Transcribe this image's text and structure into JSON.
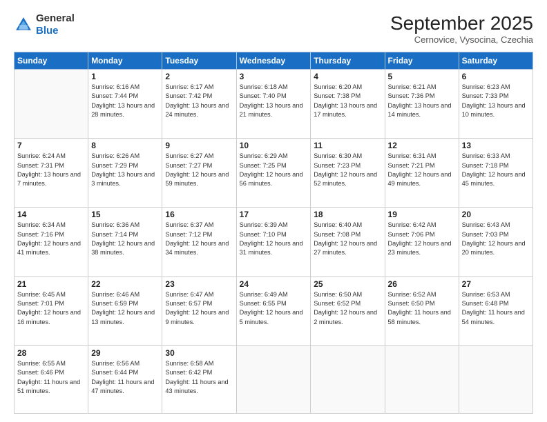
{
  "header": {
    "logo_line1": "General",
    "logo_line2": "Blue",
    "month": "September 2025",
    "location": "Cernovice, Vysocina, Czechia"
  },
  "days_of_week": [
    "Sunday",
    "Monday",
    "Tuesday",
    "Wednesday",
    "Thursday",
    "Friday",
    "Saturday"
  ],
  "weeks": [
    [
      {
        "day": "",
        "info": ""
      },
      {
        "day": "1",
        "info": "Sunrise: 6:16 AM\nSunset: 7:44 PM\nDaylight: 13 hours and 28 minutes."
      },
      {
        "day": "2",
        "info": "Sunrise: 6:17 AM\nSunset: 7:42 PM\nDaylight: 13 hours and 24 minutes."
      },
      {
        "day": "3",
        "info": "Sunrise: 6:18 AM\nSunset: 7:40 PM\nDaylight: 13 hours and 21 minutes."
      },
      {
        "day": "4",
        "info": "Sunrise: 6:20 AM\nSunset: 7:38 PM\nDaylight: 13 hours and 17 minutes."
      },
      {
        "day": "5",
        "info": "Sunrise: 6:21 AM\nSunset: 7:36 PM\nDaylight: 13 hours and 14 minutes."
      },
      {
        "day": "6",
        "info": "Sunrise: 6:23 AM\nSunset: 7:33 PM\nDaylight: 13 hours and 10 minutes."
      }
    ],
    [
      {
        "day": "7",
        "info": "Sunrise: 6:24 AM\nSunset: 7:31 PM\nDaylight: 13 hours and 7 minutes."
      },
      {
        "day": "8",
        "info": "Sunrise: 6:26 AM\nSunset: 7:29 PM\nDaylight: 13 hours and 3 minutes."
      },
      {
        "day": "9",
        "info": "Sunrise: 6:27 AM\nSunset: 7:27 PM\nDaylight: 12 hours and 59 minutes."
      },
      {
        "day": "10",
        "info": "Sunrise: 6:29 AM\nSunset: 7:25 PM\nDaylight: 12 hours and 56 minutes."
      },
      {
        "day": "11",
        "info": "Sunrise: 6:30 AM\nSunset: 7:23 PM\nDaylight: 12 hours and 52 minutes."
      },
      {
        "day": "12",
        "info": "Sunrise: 6:31 AM\nSunset: 7:21 PM\nDaylight: 12 hours and 49 minutes."
      },
      {
        "day": "13",
        "info": "Sunrise: 6:33 AM\nSunset: 7:18 PM\nDaylight: 12 hours and 45 minutes."
      }
    ],
    [
      {
        "day": "14",
        "info": "Sunrise: 6:34 AM\nSunset: 7:16 PM\nDaylight: 12 hours and 41 minutes."
      },
      {
        "day": "15",
        "info": "Sunrise: 6:36 AM\nSunset: 7:14 PM\nDaylight: 12 hours and 38 minutes."
      },
      {
        "day": "16",
        "info": "Sunrise: 6:37 AM\nSunset: 7:12 PM\nDaylight: 12 hours and 34 minutes."
      },
      {
        "day": "17",
        "info": "Sunrise: 6:39 AM\nSunset: 7:10 PM\nDaylight: 12 hours and 31 minutes."
      },
      {
        "day": "18",
        "info": "Sunrise: 6:40 AM\nSunset: 7:08 PM\nDaylight: 12 hours and 27 minutes."
      },
      {
        "day": "19",
        "info": "Sunrise: 6:42 AM\nSunset: 7:06 PM\nDaylight: 12 hours and 23 minutes."
      },
      {
        "day": "20",
        "info": "Sunrise: 6:43 AM\nSunset: 7:03 PM\nDaylight: 12 hours and 20 minutes."
      }
    ],
    [
      {
        "day": "21",
        "info": "Sunrise: 6:45 AM\nSunset: 7:01 PM\nDaylight: 12 hours and 16 minutes."
      },
      {
        "day": "22",
        "info": "Sunrise: 6:46 AM\nSunset: 6:59 PM\nDaylight: 12 hours and 13 minutes."
      },
      {
        "day": "23",
        "info": "Sunrise: 6:47 AM\nSunset: 6:57 PM\nDaylight: 12 hours and 9 minutes."
      },
      {
        "day": "24",
        "info": "Sunrise: 6:49 AM\nSunset: 6:55 PM\nDaylight: 12 hours and 5 minutes."
      },
      {
        "day": "25",
        "info": "Sunrise: 6:50 AM\nSunset: 6:52 PM\nDaylight: 12 hours and 2 minutes."
      },
      {
        "day": "26",
        "info": "Sunrise: 6:52 AM\nSunset: 6:50 PM\nDaylight: 11 hours and 58 minutes."
      },
      {
        "day": "27",
        "info": "Sunrise: 6:53 AM\nSunset: 6:48 PM\nDaylight: 11 hours and 54 minutes."
      }
    ],
    [
      {
        "day": "28",
        "info": "Sunrise: 6:55 AM\nSunset: 6:46 PM\nDaylight: 11 hours and 51 minutes."
      },
      {
        "day": "29",
        "info": "Sunrise: 6:56 AM\nSunset: 6:44 PM\nDaylight: 11 hours and 47 minutes."
      },
      {
        "day": "30",
        "info": "Sunrise: 6:58 AM\nSunset: 6:42 PM\nDaylight: 11 hours and 43 minutes."
      },
      {
        "day": "",
        "info": ""
      },
      {
        "day": "",
        "info": ""
      },
      {
        "day": "",
        "info": ""
      },
      {
        "day": "",
        "info": ""
      }
    ]
  ]
}
